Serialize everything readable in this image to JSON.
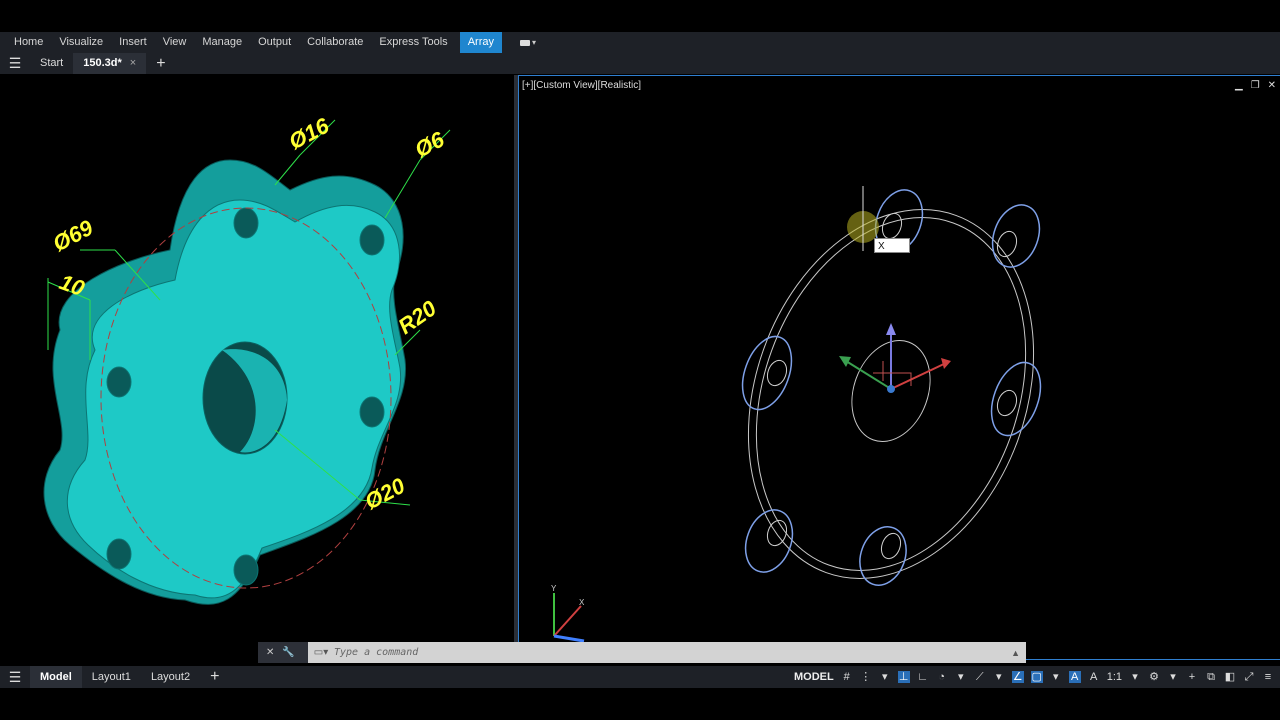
{
  "ribbon": {
    "tabs": [
      "Home",
      "Visualize",
      "Insert",
      "View",
      "Manage",
      "Output",
      "Collaborate",
      "Express Tools"
    ],
    "active_tab": "Array"
  },
  "doc_tabs": {
    "start": "Start",
    "active_doc": "150.3d*",
    "close_symbol": "×",
    "new_symbol": "+"
  },
  "left_viewport": {
    "dimensions": {
      "d16": "Ø16",
      "d6": "Ø6",
      "d69": "Ø69",
      "ten": "10",
      "r20": "R20",
      "d20": "Ø20"
    }
  },
  "right_viewport": {
    "label": "[+][Custom View][Realistic]",
    "cursor_input": "X"
  },
  "command_line": {
    "placeholder": "Type a command"
  },
  "layout_tabs": {
    "tabs": [
      "Model",
      "Layout1",
      "Layout2"
    ],
    "active": "Model",
    "new_symbol": "+"
  },
  "status_bar": {
    "model_label": "MODEL",
    "scale": "1:1"
  },
  "colors": {
    "accent": "#1f86cf",
    "part_fill": "#1ec9c6",
    "dimension_text": "#ffff33",
    "wire": "#c9d6f2"
  }
}
